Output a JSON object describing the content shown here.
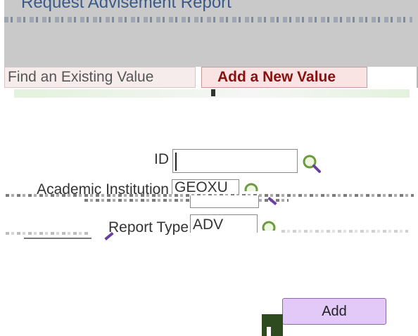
{
  "page": {
    "title": "Request Advisement Report"
  },
  "tabs": [
    {
      "label": "Find an Existing Value",
      "active": false
    },
    {
      "label": "Add a New Value",
      "active": true
    }
  ],
  "form": {
    "id": {
      "label": "ID",
      "value": ""
    },
    "institution": {
      "label": "Academic Institution",
      "value": "GEOXU"
    },
    "report_type": {
      "label": "Report Type",
      "value": "ADV"
    }
  },
  "actions": {
    "add_label": "Add"
  },
  "colors": {
    "header_band": "#c9c9c9",
    "active_tab_text": "#8a1010",
    "add_button": "#e3c9f7"
  }
}
